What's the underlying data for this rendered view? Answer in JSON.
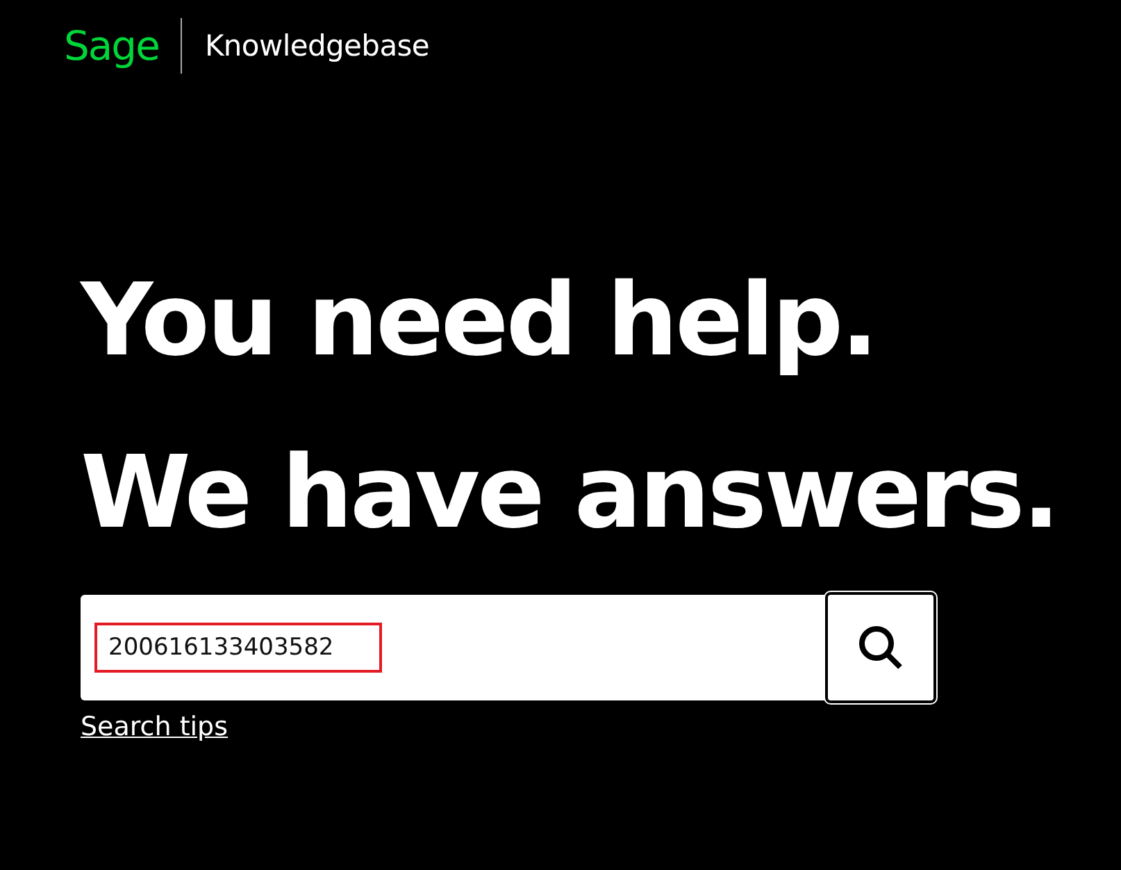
{
  "header": {
    "logo": "Sage",
    "title": "Knowledgebase"
  },
  "headline": [
    "You need help.",
    "We have answers."
  ],
  "search": {
    "value": "200616133403582"
  },
  "search_tips": "Search tips"
}
